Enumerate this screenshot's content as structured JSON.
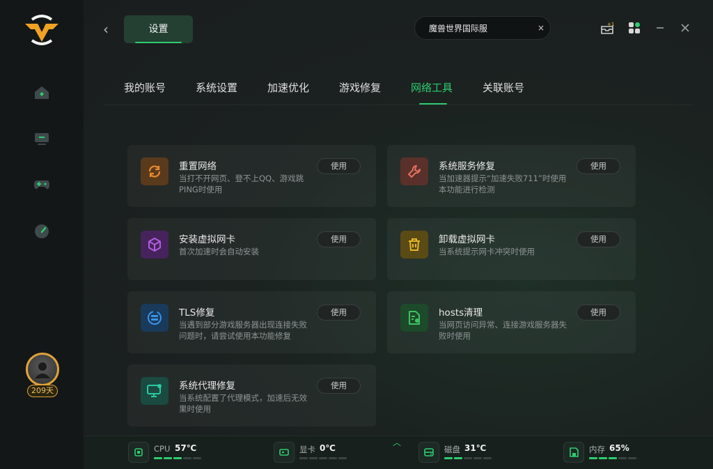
{
  "sidebar": {
    "items": [
      {
        "icon": "home-icon"
      },
      {
        "icon": "monitor-icon"
      },
      {
        "icon": "gamepad-icon"
      },
      {
        "icon": "speedometer-icon"
      }
    ],
    "user": {
      "level": "3",
      "days": "209天"
    }
  },
  "header": {
    "settings_tab": "设置",
    "search_value": "魔兽世界国际服",
    "clear_label": "×",
    "back_label": "‹"
  },
  "tabs": [
    {
      "label": "我的账号"
    },
    {
      "label": "系统设置"
    },
    {
      "label": "加速优化"
    },
    {
      "label": "游戏修复"
    },
    {
      "label": "网络工具",
      "active": true
    },
    {
      "label": "关联账号"
    }
  ],
  "cards": [
    {
      "title": "重置网络",
      "desc": "当打不开网页、登不上QQ、游戏跳PING时使用",
      "button": "使用",
      "icon": "refresh-icon",
      "color": "#e8892b"
    },
    {
      "title": "系统服务修复",
      "desc": "当加速器提示“加速失败711”时使用本功能进行检测",
      "button": "使用",
      "icon": "wrench-icon",
      "color": "#e0705e"
    },
    {
      "title": "安装虚拟网卡",
      "desc": "首次加速时会自动安装",
      "button": "使用",
      "icon": "cube-icon",
      "color": "#b35de0"
    },
    {
      "title": "卸载虚拟网卡",
      "desc": "当系统提示网卡冲突时使用",
      "button": "使用",
      "icon": "trash-icon",
      "color": "#e6b62a"
    },
    {
      "title": "TLS修复",
      "desc": "当遇到部分游戏服务器出现连接失败问题时，请尝试使用本功能修复",
      "button": "使用",
      "icon": "tls-icon",
      "color": "#3b93e8"
    },
    {
      "title": "hosts清理",
      "desc": "当网页访问异常、连接游戏服务器失败时使用",
      "button": "使用",
      "icon": "file-clean-icon",
      "color": "#3fc160"
    },
    {
      "title": "系统代理修复",
      "desc": "当系统配置了代理模式，加速后无效果时使用",
      "button": "使用",
      "icon": "monitor-repair-icon",
      "color": "#2cc9a3"
    }
  ],
  "status": [
    {
      "label": "CPU",
      "value": "57℃",
      "icon": "cpu-icon",
      "level": 3
    },
    {
      "label": "显卡",
      "value": "0℃",
      "icon": "gpu-icon",
      "level": 0
    },
    {
      "label": "磁盘",
      "value": "31℃",
      "icon": "disk-icon",
      "level": 2
    },
    {
      "label": "内存",
      "value": "65%",
      "icon": "memory-icon",
      "level": 3
    }
  ],
  "colors": {
    "accent": "#2ecc71",
    "gold": "#e0a23a"
  }
}
